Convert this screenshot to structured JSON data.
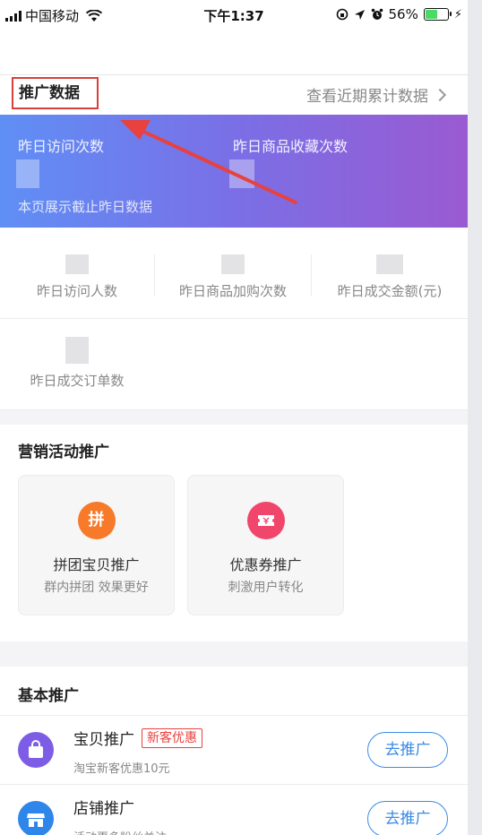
{
  "status_bar": {
    "carrier": "中国移动",
    "time": "下午1:37",
    "battery": "56%"
  },
  "header": {
    "title": "推广数据",
    "link": "查看近期累计数据"
  },
  "banner": {
    "label_visits": "昨日访问次数",
    "label_favorites": "昨日商品收藏次数",
    "note": "本页展示截止昨日数据"
  },
  "stats": [
    {
      "label": "昨日访问人数"
    },
    {
      "label": "昨日商品加购次数"
    },
    {
      "label": "昨日成交金额(元)"
    },
    {
      "label": "昨日成交订单数"
    }
  ],
  "marketing": {
    "title": "营销活动推广",
    "cards": [
      {
        "icon_text": "拼",
        "title": "拼团宝贝推广",
        "subtitle": "群内拼团 效果更好",
        "color": "#f77a2b"
      },
      {
        "icon_text": "",
        "title": "优惠券推广",
        "subtitle": "刺激用户转化",
        "color": "#f0466b"
      }
    ]
  },
  "basic": {
    "title": "基本推广",
    "items": [
      {
        "title": "宝贝推广",
        "tag": "新客优惠",
        "subtitle": "淘宝新客优惠10元",
        "button": "去推广",
        "color": "#7d5de6"
      },
      {
        "title": "店铺推广",
        "subtitle": "活动更多粉丝关注",
        "button": "去推广",
        "color": "#2f86ea"
      }
    ]
  },
  "colors": {
    "accent_red": "#e8413e",
    "accent_blue": "#3b8ae6",
    "banner_start": "#5f8ff5",
    "banner_end": "#9a5ad1"
  }
}
